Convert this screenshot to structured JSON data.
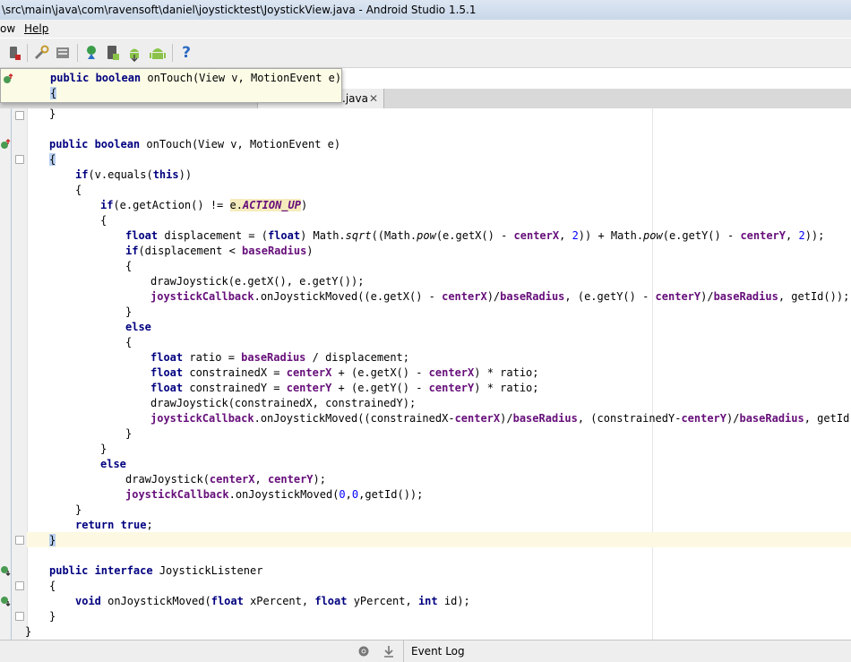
{
  "window": {
    "title": "\\src\\main\\java\\com\\ravensoft\\daniel\\joysticktest\\JoystickView.java - Android Studio 1.5.1"
  },
  "menu": {
    "items": [
      "ow",
      "Help"
    ]
  },
  "toolbar": {
    "icons": [
      "android-device-icon",
      "project-structure-icon",
      "sdk-tools-icon",
      "sync-gradle-icon",
      "avd-manager-icon",
      "android-monitor-icon",
      "android-logo-icon",
      "help-icon"
    ],
    "help_label": "?"
  },
  "editor_tab": {
    "label": ".java",
    "close": "✕"
  },
  "popup": {
    "line1": "public boolean onTouch(View v, MotionEvent e)",
    "line2": "{"
  },
  "code": {
    "lines": [
      "    }",
      "",
      "    public boolean onTouch(View v, MotionEvent e)",
      "    {",
      "        if(v.equals(this))",
      "        {",
      "            if(e.getAction() != e.ACTION_UP)",
      "            {",
      "                float displacement = (float) Math.sqrt((Math.pow(e.getX() - centerX, 2)) + Math.pow(e.getY() - centerY, 2));",
      "                if(displacement < baseRadius)",
      "                {",
      "                    drawJoystick(e.getX(), e.getY());",
      "                    joystickCallback.onJoystickMoved((e.getX() - centerX)/baseRadius, (e.getY() - centerY)/baseRadius, getId());",
      "                }",
      "                else",
      "                {",
      "                    float ratio = baseRadius / displacement;",
      "                    float constrainedX = centerX + (e.getX() - centerX) * ratio;",
      "                    float constrainedY = centerY + (e.getY() - centerY) * ratio;",
      "                    drawJoystick(constrainedX, constrainedY);",
      "                    joystickCallback.onJoystickMoved((constrainedX-centerX)/baseRadius, (constrainedY-centerY)/baseRadius, getId());",
      "                }",
      "            }",
      "            else",
      "                drawJoystick(centerX, centerY);",
      "                joystickCallback.onJoystickMoved(0,0,getId());",
      "        }",
      "        return true;",
      "    }",
      "",
      "    public interface JoystickListener",
      "    {",
      "        void onJoystickMoved(float xPercent, float yPercent, int id);",
      "    }",
      "}"
    ]
  },
  "statusbar": {
    "event_log": "Event Log"
  },
  "colors": {
    "keyword": "#000080",
    "field": "#660e7a",
    "number": "#0000ff",
    "caret_line": "#fdf8e2"
  }
}
